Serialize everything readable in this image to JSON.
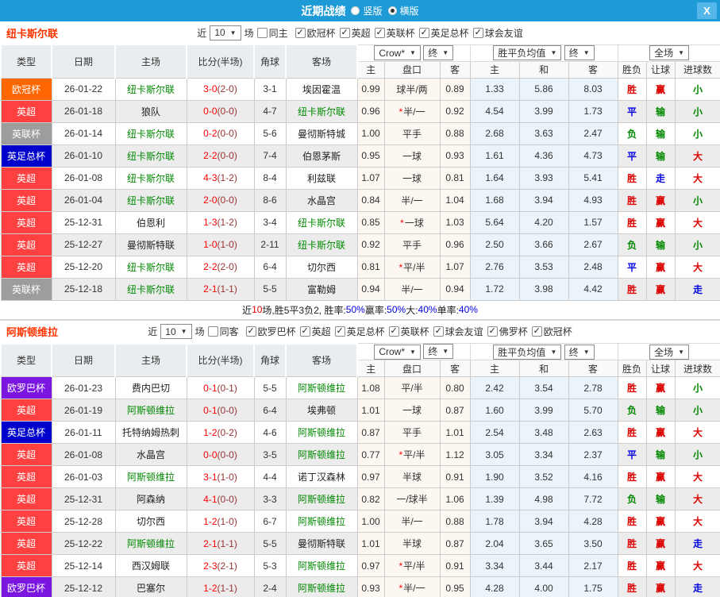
{
  "titlebar": {
    "title": "近期战绩",
    "vertical_label": "竖版",
    "horizontal_label": "横版",
    "close_glyph": "X"
  },
  "table_head": {
    "cols": [
      "类型",
      "日期",
      "主场",
      "比分(半场)",
      "角球",
      "客场"
    ],
    "sub_cols": [
      "主",
      "盘口",
      "客",
      "主",
      "和",
      "客",
      "胜负",
      "让球",
      "进球数"
    ],
    "bookmaker": "Crow*",
    "time1": "终",
    "europe_metric": "胜平负均值",
    "time2": "终",
    "scope": "全场"
  },
  "type_colors": {
    "欧冠杯": "#ff6600",
    "英超": "#ff4040",
    "英联杯": "#9d9d9d",
    "英足总杯": "#0000cc",
    "欧罗巴杯": "#7a16e0"
  },
  "value_colors": {
    "胜": "#dd0000",
    "平": "#0000dd",
    "负": "#008800",
    "赢": "#dd0000",
    "输": "#008800",
    "走": "#0000dd",
    "大": "#dd0000",
    "小": "#008800"
  },
  "sections": [
    {
      "team": "纽卡斯尔联",
      "filter": {
        "near": "近",
        "count": "10",
        "games": "场",
        "same": "同主",
        "same_checked": false,
        "leagues": [
          {
            "label": "欧冠杯",
            "checked": true
          },
          {
            "label": "英超",
            "checked": true
          },
          {
            "label": "英联杯",
            "checked": true
          },
          {
            "label": "英足总杯",
            "checked": true
          },
          {
            "label": "球会友谊",
            "checked": true
          }
        ]
      },
      "rows": [
        {
          "type": "欧冠杯",
          "date": "26-01-22",
          "home": "纽卡斯尔联",
          "hf": true,
          "score": "3-0",
          "half": "(2-0)",
          "corner": "3-1",
          "away": "埃因霍温",
          "af": false,
          "h": "0.99",
          "hcap": "球半/两",
          "star": false,
          "a": "0.89",
          "w": "1.33",
          "d": "5.86",
          "l": "8.03",
          "r1": "胜",
          "r2": "赢",
          "r3": "小"
        },
        {
          "type": "英超",
          "date": "26-01-18",
          "home": "狼队",
          "hf": false,
          "score": "0-0",
          "half": "(0-0)",
          "corner": "4-7",
          "away": "纽卡斯尔联",
          "af": true,
          "h": "0.96",
          "hcap": "半/一",
          "star": true,
          "a": "0.92",
          "w": "4.54",
          "d": "3.99",
          "l": "1.73",
          "r1": "平",
          "r2": "输",
          "r3": "小"
        },
        {
          "type": "英联杯",
          "date": "26-01-14",
          "home": "纽卡斯尔联",
          "hf": true,
          "score": "0-2",
          "half": "(0-0)",
          "corner": "5-6",
          "away": "曼彻斯特城",
          "af": false,
          "h": "1.00",
          "hcap": "平手",
          "star": false,
          "a": "0.88",
          "w": "2.68",
          "d": "3.63",
          "l": "2.47",
          "r1": "负",
          "r2": "输",
          "r3": "小"
        },
        {
          "type": "英足总杯",
          "date": "26-01-10",
          "home": "纽卡斯尔联",
          "hf": true,
          "score": "2-2",
          "half": "(0-0)",
          "corner": "7-4",
          "away": "伯恩茅斯",
          "af": false,
          "h": "0.95",
          "hcap": "一球",
          "star": false,
          "a": "0.93",
          "w": "1.61",
          "d": "4.36",
          "l": "4.73",
          "r1": "平",
          "r2": "输",
          "r3": "大"
        },
        {
          "type": "英超",
          "date": "26-01-08",
          "home": "纽卡斯尔联",
          "hf": true,
          "score": "4-3",
          "half": "(1-2)",
          "corner": "8-4",
          "away": "利兹联",
          "af": false,
          "h": "1.07",
          "hcap": "一球",
          "star": false,
          "a": "0.81",
          "w": "1.64",
          "d": "3.93",
          "l": "5.41",
          "r1": "胜",
          "r2": "走",
          "r3": "大"
        },
        {
          "type": "英超",
          "date": "26-01-04",
          "home": "纽卡斯尔联",
          "hf": true,
          "score": "2-0",
          "half": "(0-0)",
          "corner": "8-6",
          "away": "水晶宫",
          "af": false,
          "h": "0.84",
          "hcap": "半/一",
          "star": false,
          "a": "1.04",
          "w": "1.68",
          "d": "3.94",
          "l": "4.93",
          "r1": "胜",
          "r2": "赢",
          "r3": "小"
        },
        {
          "type": "英超",
          "date": "25-12-31",
          "home": "伯恩利",
          "hf": false,
          "score": "1-3",
          "half": "(1-2)",
          "corner": "3-4",
          "away": "纽卡斯尔联",
          "af": true,
          "h": "0.85",
          "hcap": "一球",
          "star": true,
          "a": "1.03",
          "w": "5.64",
          "d": "4.20",
          "l": "1.57",
          "r1": "胜",
          "r2": "赢",
          "r3": "大"
        },
        {
          "type": "英超",
          "date": "25-12-27",
          "home": "曼彻斯特联",
          "hf": false,
          "score": "1-0",
          "half": "(1-0)",
          "corner": "2-11",
          "away": "纽卡斯尔联",
          "af": true,
          "h": "0.92",
          "hcap": "平手",
          "star": false,
          "a": "0.96",
          "w": "2.50",
          "d": "3.66",
          "l": "2.67",
          "r1": "负",
          "r2": "输",
          "r3": "小"
        },
        {
          "type": "英超",
          "date": "25-12-20",
          "home": "纽卡斯尔联",
          "hf": true,
          "score": "2-2",
          "half": "(2-0)",
          "corner": "6-4",
          "away": "切尔西",
          "af": false,
          "h": "0.81",
          "hcap": "平/半",
          "star": true,
          "a": "1.07",
          "w": "2.76",
          "d": "3.53",
          "l": "2.48",
          "r1": "平",
          "r2": "赢",
          "r3": "大"
        },
        {
          "type": "英联杯",
          "date": "25-12-18",
          "home": "纽卡斯尔联",
          "hf": true,
          "score": "2-1",
          "half": "(1-1)",
          "corner": "5-5",
          "away": "富勒姆",
          "af": false,
          "h": "0.94",
          "hcap": "半/一",
          "star": false,
          "a": "0.94",
          "w": "1.72",
          "d": "3.98",
          "l": "4.42",
          "r1": "胜",
          "r2": "赢",
          "r3": "走"
        }
      ],
      "summary": [
        {
          "text": "近",
          "color": "dark"
        },
        {
          "text": "10",
          "color": "red"
        },
        {
          "text": "场,胜5平3负2, 胜率:",
          "color": "dark"
        },
        {
          "text": "50%",
          "color": "blue"
        },
        {
          "text": " 赢率:",
          "color": "dark"
        },
        {
          "text": "50%",
          "color": "blue"
        },
        {
          "text": " 大:",
          "color": "dark"
        },
        {
          "text": "40%",
          "color": "blue"
        },
        {
          "text": " 单率:",
          "color": "dark"
        },
        {
          "text": "40%",
          "color": "blue"
        }
      ]
    },
    {
      "team": "阿斯顿维拉",
      "filter": {
        "near": "近",
        "count": "10",
        "games": "场",
        "same": "同客",
        "same_checked": false,
        "leagues": [
          {
            "label": "欧罗巴杯",
            "checked": true
          },
          {
            "label": "英超",
            "checked": true
          },
          {
            "label": "英足总杯",
            "checked": true
          },
          {
            "label": "英联杯",
            "checked": true
          },
          {
            "label": "球会友谊",
            "checked": true
          },
          {
            "label": "佛罗杯",
            "checked": true
          },
          {
            "label": "欧冠杯",
            "checked": true
          }
        ]
      },
      "rows": [
        {
          "type": "欧罗巴杯",
          "date": "26-01-23",
          "home": "费内巴切",
          "hf": false,
          "score": "0-1",
          "half": "(0-1)",
          "corner": "5-5",
          "away": "阿斯顿维拉",
          "af": true,
          "h": "1.08",
          "hcap": "平/半",
          "star": false,
          "a": "0.80",
          "w": "2.42",
          "d": "3.54",
          "l": "2.78",
          "r1": "胜",
          "r2": "赢",
          "r3": "小"
        },
        {
          "type": "英超",
          "date": "26-01-19",
          "home": "阿斯顿维拉",
          "hf": true,
          "score": "0-1",
          "half": "(0-0)",
          "corner": "6-4",
          "away": "埃弗顿",
          "af": false,
          "h": "1.01",
          "hcap": "一球",
          "star": false,
          "a": "0.87",
          "w": "1.60",
          "d": "3.99",
          "l": "5.70",
          "r1": "负",
          "r2": "输",
          "r3": "小"
        },
        {
          "type": "英足总杯",
          "date": "26-01-11",
          "home": "托特纳姆热刺",
          "hf": false,
          "score": "1-2",
          "half": "(0-2)",
          "corner": "4-6",
          "away": "阿斯顿维拉",
          "af": true,
          "h": "0.87",
          "hcap": "平手",
          "star": false,
          "a": "1.01",
          "w": "2.54",
          "d": "3.48",
          "l": "2.63",
          "r1": "胜",
          "r2": "赢",
          "r3": "大"
        },
        {
          "type": "英超",
          "date": "26-01-08",
          "home": "水晶宫",
          "hf": false,
          "score": "0-0",
          "half": "(0-0)",
          "corner": "3-5",
          "away": "阿斯顿维拉",
          "af": true,
          "h": "0.77",
          "hcap": "平/半",
          "star": true,
          "a": "1.12",
          "w": "3.05",
          "d": "3.34",
          "l": "2.37",
          "r1": "平",
          "r2": "输",
          "r3": "小"
        },
        {
          "type": "英超",
          "date": "26-01-03",
          "home": "阿斯顿维拉",
          "hf": true,
          "score": "3-1",
          "half": "(1-0)",
          "corner": "4-4",
          "away": "诺丁汉森林",
          "af": false,
          "h": "0.97",
          "hcap": "半球",
          "star": false,
          "a": "0.91",
          "w": "1.90",
          "d": "3.52",
          "l": "4.16",
          "r1": "胜",
          "r2": "赢",
          "r3": "大"
        },
        {
          "type": "英超",
          "date": "25-12-31",
          "home": "阿森纳",
          "hf": false,
          "score": "4-1",
          "half": "(0-0)",
          "corner": "3-3",
          "away": "阿斯顿维拉",
          "af": true,
          "h": "0.82",
          "hcap": "一/球半",
          "star": false,
          "a": "1.06",
          "w": "1.39",
          "d": "4.98",
          "l": "7.72",
          "r1": "负",
          "r2": "输",
          "r3": "大"
        },
        {
          "type": "英超",
          "date": "25-12-28",
          "home": "切尔西",
          "hf": false,
          "score": "1-2",
          "half": "(1-0)",
          "corner": "6-7",
          "away": "阿斯顿维拉",
          "af": true,
          "h": "1.00",
          "hcap": "半/一",
          "star": false,
          "a": "0.88",
          "w": "1.78",
          "d": "3.94",
          "l": "4.28",
          "r1": "胜",
          "r2": "赢",
          "r3": "大"
        },
        {
          "type": "英超",
          "date": "25-12-22",
          "home": "阿斯顿维拉",
          "hf": true,
          "score": "2-1",
          "half": "(1-1)",
          "corner": "5-5",
          "away": "曼彻斯特联",
          "af": false,
          "h": "1.01",
          "hcap": "半球",
          "star": false,
          "a": "0.87",
          "w": "2.04",
          "d": "3.65",
          "l": "3.50",
          "r1": "胜",
          "r2": "赢",
          "r3": "走"
        },
        {
          "type": "英超",
          "date": "25-12-14",
          "home": "西汉姆联",
          "hf": false,
          "score": "2-3",
          "half": "(2-1)",
          "corner": "5-3",
          "away": "阿斯顿维拉",
          "af": true,
          "h": "0.97",
          "hcap": "平/半",
          "star": true,
          "a": "0.91",
          "w": "3.34",
          "d": "3.44",
          "l": "2.17",
          "r1": "胜",
          "r2": "赢",
          "r3": "大"
        },
        {
          "type": "欧罗巴杯",
          "date": "25-12-12",
          "home": "巴塞尔",
          "hf": false,
          "score": "1-2",
          "half": "(1-1)",
          "corner": "2-4",
          "away": "阿斯顿维拉",
          "af": true,
          "h": "0.93",
          "hcap": "半/一",
          "star": true,
          "a": "0.95",
          "w": "4.28",
          "d": "4.00",
          "l": "1.75",
          "r1": "胜",
          "r2": "赢",
          "r3": "走"
        }
      ],
      "summary": []
    }
  ]
}
